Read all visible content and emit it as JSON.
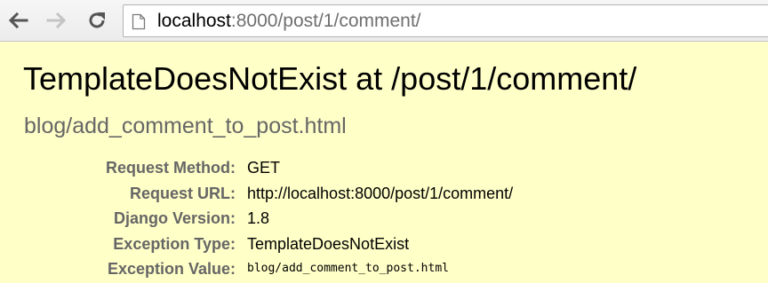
{
  "browser": {
    "url_host": "localhost",
    "url_rest": ":8000/post/1/comment/",
    "back_icon": "arrow-left-icon",
    "forward_icon": "arrow-right-icon",
    "reload_icon": "reload-icon",
    "page_icon": "page-icon"
  },
  "error": {
    "title": "TemplateDoesNotExist at /post/1/comment/",
    "subtitle": "blog/add_comment_to_post.html"
  },
  "meta": [
    {
      "label": "Request Method:",
      "value": "GET"
    },
    {
      "label": "Request URL:",
      "value": "http://localhost:8000/post/1/comment/"
    },
    {
      "label": "Django Version:",
      "value": "1.8"
    },
    {
      "label": "Exception Type:",
      "value": "TemplateDoesNotExist"
    },
    {
      "label": "Exception Value:",
      "value": "blog/add_comment_to_post.html"
    }
  ],
  "colors": {
    "page_background": "#ffffc8",
    "label_gray": "#666666",
    "toolbar": "#f2f2f2"
  }
}
